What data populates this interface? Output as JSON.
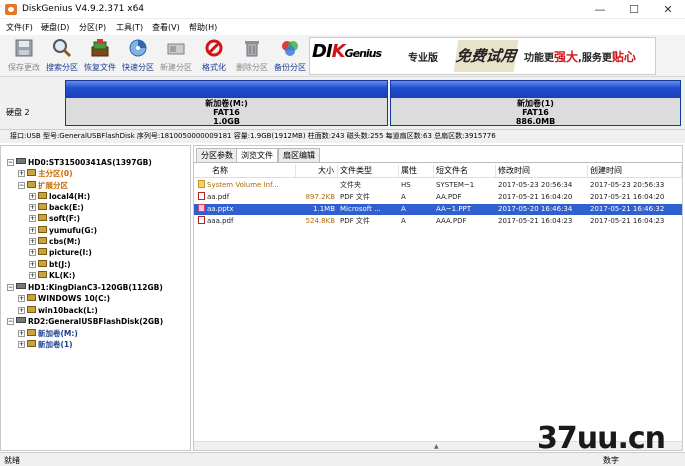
{
  "window": {
    "title": "DiskGenius V4.9.2.371 x64",
    "controls": {
      "minimize": "—",
      "maximize": "☐",
      "close": "✕"
    }
  },
  "menu": [
    "文件(F)",
    "硬盘(D)",
    "分区(P)",
    "工具(T)",
    "查看(V)",
    "帮助(H)"
  ],
  "toolbar": [
    {
      "label": "保存更改",
      "icon": "save-icon",
      "enabled": false
    },
    {
      "label": "搜索分区",
      "icon": "search-icon",
      "enabled": true
    },
    {
      "label": "恢复文件",
      "icon": "recover-icon",
      "enabled": true
    },
    {
      "label": "快速分区",
      "icon": "quick-partition-icon",
      "enabled": true
    },
    {
      "label": "新建分区",
      "icon": "new-partition-icon",
      "enabled": false
    },
    {
      "label": "格式化",
      "icon": "format-icon",
      "enabled": true
    },
    {
      "label": "删除分区",
      "icon": "delete-icon",
      "enabled": false
    },
    {
      "label": "备份分区",
      "icon": "backup-icon",
      "enabled": true
    }
  ],
  "banner": {
    "logo_a": "DI",
    "logo_b": "K",
    "logo_c": "Genius",
    "pro": "专业版",
    "free": "免费试用",
    "slogan_a": "功能更",
    "slogan_b": "强大",
    "slogan_c": ",服务更",
    "slogan_d": "贴心"
  },
  "diskmap": {
    "disk_label": "硬盘 2",
    "partitions": [
      {
        "name": "新加卷(M:)",
        "fs": "FAT16",
        "size": "1.0GB"
      },
      {
        "name": "新加卷(1)",
        "fs": "FAT16",
        "size": "886.0MB"
      }
    ]
  },
  "infobar": "接口:USB  型号:GeneralUSBFlashDisk  序列号:1810050000009181  容量:1.9GB(1912MB)  柱面数:243  磁头数:255  每道扇区数:63  总扇区数:3915776",
  "tree": [
    {
      "text": "HD0:ST31500341AS(1397GB)",
      "kind": "disk",
      "level": 0,
      "exp": "−"
    },
    {
      "text": "主分区(0)",
      "kind": "part",
      "level": 1,
      "exp": "+"
    },
    {
      "text": "扩展分区",
      "kind": "part",
      "level": 1,
      "exp": "−"
    },
    {
      "text": "local4(H:)",
      "kind": "part",
      "level": 2,
      "exp": "+"
    },
    {
      "text": "back(E:)",
      "kind": "part",
      "level": 2,
      "exp": "+"
    },
    {
      "text": "soft(F:)",
      "kind": "part",
      "level": 2,
      "exp": "+"
    },
    {
      "text": "yumufu(G:)",
      "kind": "part",
      "level": 2,
      "exp": "+"
    },
    {
      "text": "cbs(M:)",
      "kind": "part",
      "level": 2,
      "exp": "+"
    },
    {
      "text": "picture(I:)",
      "kind": "part",
      "level": 2,
      "exp": "+"
    },
    {
      "text": "bt(J:)",
      "kind": "part",
      "level": 2,
      "exp": "+"
    },
    {
      "text": "KL(K:)",
      "kind": "part",
      "level": 2,
      "exp": "+"
    },
    {
      "text": "HD1:KingDianC3-120GB(112GB)",
      "kind": "disk",
      "level": 0,
      "exp": "−"
    },
    {
      "text": "WINDOWS 10(C:)",
      "kind": "part",
      "level": 1,
      "exp": "+"
    },
    {
      "text": "win10back(L:)",
      "kind": "part",
      "level": 1,
      "exp": "+"
    },
    {
      "text": "RD2:GeneralUSBFlashDisk(2GB)",
      "kind": "disk",
      "level": 0,
      "exp": "−"
    },
    {
      "text": "新加卷(M:)",
      "kind": "part",
      "level": 1,
      "exp": "+"
    },
    {
      "text": "新加卷(1)",
      "kind": "part",
      "level": 1,
      "exp": "+"
    }
  ],
  "tabs": [
    "分区参数",
    "浏览文件",
    "扇区编辑"
  ],
  "active_tab": 1,
  "columns": [
    "名称",
    "大小",
    "文件类型",
    "属性",
    "短文件名",
    "修改时间",
    "创建时间"
  ],
  "files": [
    {
      "name": "System Volume Inf...",
      "size": "",
      "type": "文件夹",
      "attr": "HS",
      "short": "SYSTEM~1",
      "modified": "2017-05-23 20:56:34",
      "created": "2017-05-23 20:56:33",
      "icon": "folder-icon"
    },
    {
      "name": "aa.pdf",
      "size": "897.2KB",
      "type": "PDF 文件",
      "attr": "A",
      "short": "AA.PDF",
      "modified": "2017-05-21 16:04:20",
      "created": "2017-05-21 16:04:20",
      "icon": "pdf-file-icon"
    },
    {
      "name": "aa.pptx",
      "size": "1.1MB",
      "type": "Microsoft ...",
      "attr": "A",
      "short": "AA~1.PPT",
      "modified": "2017-05-20 16:46:34",
      "created": "2017-05-21 16:46:32",
      "icon": "pptx-file-icon"
    },
    {
      "name": "aaa.pdf",
      "size": "524.8KB",
      "type": "PDF 文件",
      "attr": "A",
      "short": "AAA.PDF",
      "modified": "2017-05-21 16:04:23",
      "created": "2017-05-21 16:04:23",
      "icon": "pdf-file-icon"
    }
  ],
  "selected_file": 2,
  "status": {
    "left": "就绪",
    "right": "数字"
  },
  "watermark": "37uu.cn"
}
